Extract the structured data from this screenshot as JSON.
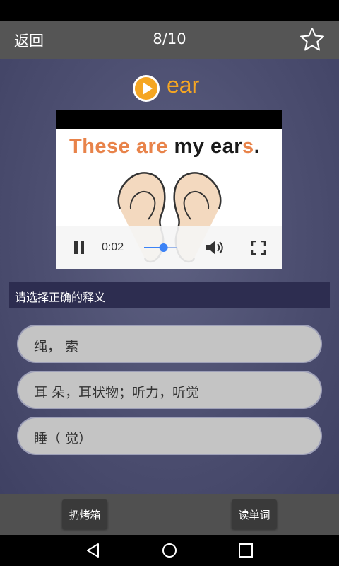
{
  "header": {
    "back_label": "返回",
    "counter": "8/10",
    "favorite_icon": "star-outline-icon"
  },
  "word": {
    "text": "ear",
    "play_icon": "play-circle-icon"
  },
  "video": {
    "caption_parts": [
      "These ",
      "are ",
      "my ear",
      "s",
      "."
    ],
    "time": "0:02",
    "progress": 0.6
  },
  "prompt": "请选择正确的释义",
  "options": [
    "绳， 索",
    "耳 朵，耳状物；听力，听觉",
    "睡（ 觉）"
  ],
  "bottom_buttons": {
    "left": "扔烤箱",
    "right": "读单词"
  },
  "colors": {
    "accent": "#f5a623",
    "caption_orange": "#e8834a",
    "slider": "#3b82f6"
  }
}
